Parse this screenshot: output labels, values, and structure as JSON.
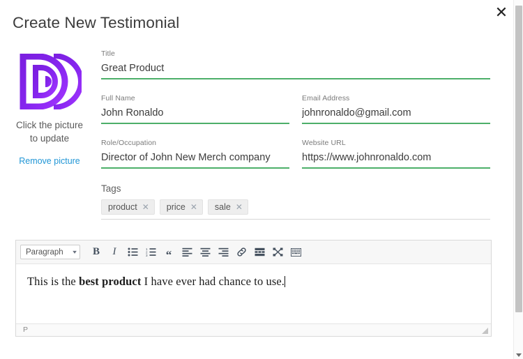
{
  "dialog": {
    "title": "Create New Testimonial",
    "close_label": "✕"
  },
  "picture": {
    "caption": "Click the picture to update",
    "remove_label": "Remove picture",
    "logo_alt": "stylized-letter-d-logo",
    "logo_colors": {
      "start": "#7b1fe0",
      "end": "#9b2cf5"
    }
  },
  "form": {
    "title_field": {
      "label": "Title",
      "value": "Great Product",
      "placeholder": "Title"
    },
    "full_name_field": {
      "label": "Full Name",
      "value": "John Ronaldo",
      "placeholder": "Full Name"
    },
    "email_field": {
      "label": "Email Address",
      "value": "johnronaldo@gmail.com",
      "placeholder": "Email Address"
    },
    "role_field": {
      "label": "Role/Occupation",
      "value": "Director of John New Merch company",
      "placeholder": "Role/Occupation"
    },
    "website_field": {
      "label": "Website URL",
      "value": "https://www.johnronaldo.com",
      "placeholder": "Website URL"
    },
    "underline_color": "#4caf69"
  },
  "tags": {
    "label": "Tags",
    "items": [
      {
        "name": "product",
        "remove": "✕"
      },
      {
        "name": "price",
        "remove": "✕"
      },
      {
        "name": "sale",
        "remove": "✕"
      }
    ]
  },
  "editor": {
    "format_select": {
      "value": "Paragraph",
      "caret": "▾"
    },
    "toolbar": [
      {
        "name": "bold-icon",
        "label": "B"
      },
      {
        "name": "italic-icon",
        "label": "I"
      },
      {
        "name": "bullet-list-icon",
        "label": ""
      },
      {
        "name": "numbered-list-icon",
        "label": ""
      },
      {
        "name": "blockquote-icon",
        "label": "“"
      },
      {
        "name": "align-left-icon",
        "label": ""
      },
      {
        "name": "align-center-icon",
        "label": ""
      },
      {
        "name": "align-right-icon",
        "label": ""
      },
      {
        "name": "link-icon",
        "label": ""
      },
      {
        "name": "table-icon",
        "label": ""
      },
      {
        "name": "fullscreen-icon",
        "label": ""
      },
      {
        "name": "source-code-icon",
        "label": ""
      }
    ],
    "content": {
      "before": "This is the ",
      "bold": "best product",
      "after": " I have ever had chance to use."
    },
    "status_path": "P"
  },
  "scrollbar": {
    "position_percent": 2
  }
}
